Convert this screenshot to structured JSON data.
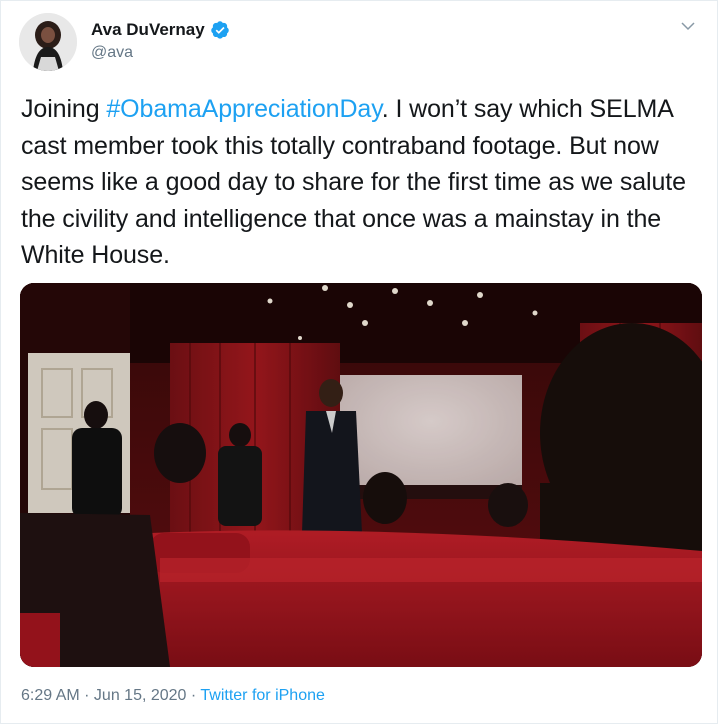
{
  "author": {
    "name": "Ava DuVernay",
    "handle": "@ava"
  },
  "tweet": {
    "text_before": "Joining ",
    "hashtag": "#ObamaAppreciationDay",
    "text_after": ". I won’t say which SELMA cast member took this totally contraband footage. But now seems like a good day to share for the first time as we salute the civility and intelligence that once was a mainstay in the White House."
  },
  "meta": {
    "time": "6:29 AM",
    "sep1": " · ",
    "date": "Jun 15, 2020",
    "sep2": " · ",
    "source": "Twitter for iPhone"
  },
  "icons": {
    "verified": "verified-badge-icon",
    "menu": "chevron-down-icon"
  },
  "colors": {
    "link": "#1da1f2",
    "muted": "#657786",
    "text": "#14171a"
  }
}
